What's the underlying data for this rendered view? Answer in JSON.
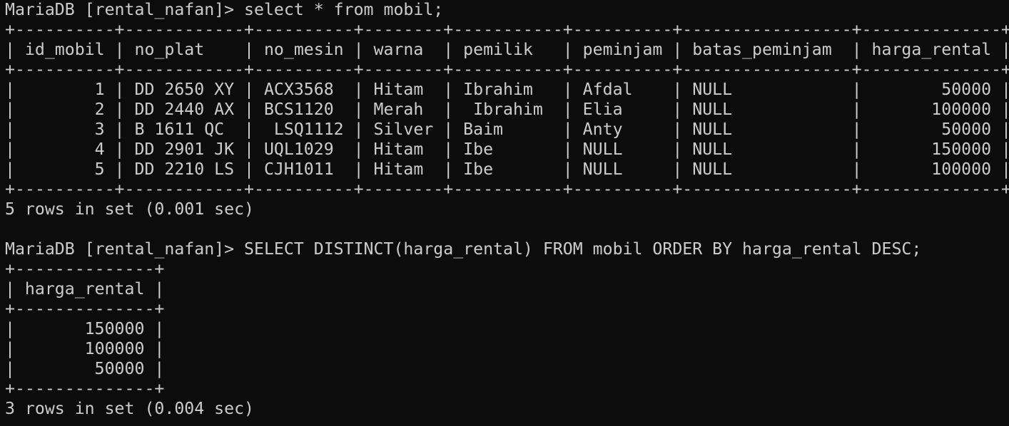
{
  "terminal": {
    "lines": [
      "MariaDB [rental_nafan]> select * from mobil;",
      "+----------+------------+----------+--------+-----------+----------+-----------------+--------------+",
      "| id_mobil | no_plat    | no_mesin | warna  | pemilik   | peminjam | batas_peminjam  | harga_rental |",
      "+----------+------------+----------+--------+-----------+----------+-----------------+--------------+",
      "|        1 | DD 2650 XY | ACX3568  | Hitam  | Ibrahim   | Afdal    | NULL            |        50000 |",
      "|        2 | DD 2440 AX | BCS1120  | Merah  |  Ibrahim  | Elia     | NULL            |       100000 |",
      "|        3 | B 1611 QC  |  LSQ1112 | Silver | Baim      | Anty     | NULL            |        50000 |",
      "|        4 | DD 2901 JK | UQL1029  | Hitam  | Ibe       | NULL     | NULL            |       150000 |",
      "|        5 | DD 2210 LS | CJH1011  | Hitam  | Ibe       | NULL     | NULL            |       100000 |",
      "+----------+------------+----------+--------+-----------+----------+-----------------+--------------+",
      "5 rows in set (0.001 sec)",
      "",
      "MariaDB [rental_nafan]> SELECT DISTINCT(harga_rental) FROM mobil ORDER BY harga_rental DESC;",
      "+--------------+",
      "| harga_rental |",
      "+--------------+",
      "|       150000 |",
      "|       100000 |",
      "|        50000 |",
      "+--------------+",
      "3 rows in set (0.004 sec)"
    ]
  }
}
